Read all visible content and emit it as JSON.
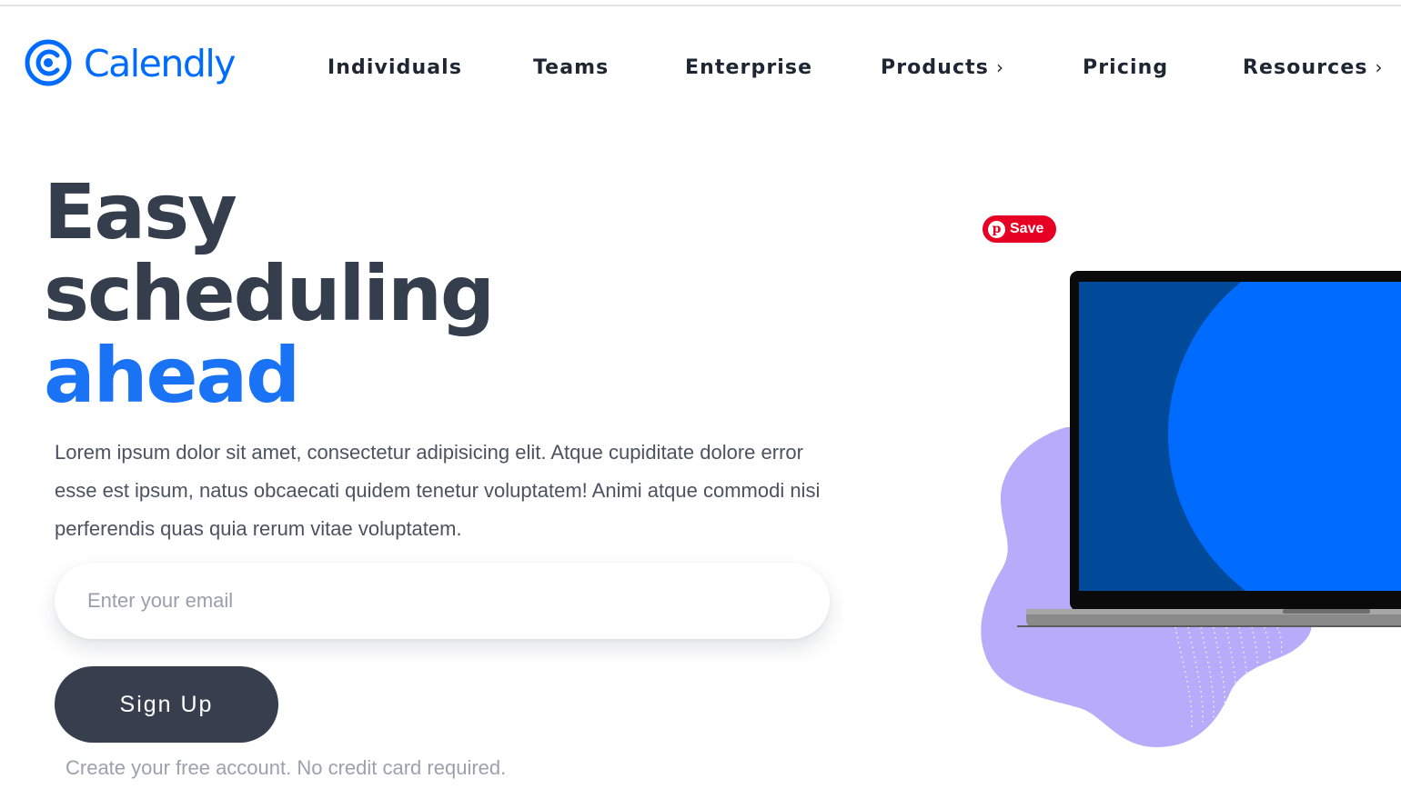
{
  "brand": {
    "name": "Calendly",
    "color": "#006bff"
  },
  "nav": {
    "items": [
      {
        "label": "Individuals",
        "has_chevron": false
      },
      {
        "label": "Teams",
        "has_chevron": false
      },
      {
        "label": "Enterprise",
        "has_chevron": false
      },
      {
        "label": "Products",
        "has_chevron": true
      },
      {
        "label": "Pricing",
        "has_chevron": false
      },
      {
        "label": "Resources",
        "has_chevron": true
      }
    ],
    "chevron_glyph": "›"
  },
  "hero": {
    "headline_lines": [
      "Easy",
      "scheduling"
    ],
    "headline_accent": "ahead",
    "description": "Lorem ipsum dolor sit amet, consectetur adipisicing elit. Atque cupiditate dolore error esse est ipsum, natus obcaecati quidem tenetur voluptatem! Animi atque commodi nisi perferendis quas quia rerum vitae voluptatem.",
    "email_placeholder": "Enter your email",
    "email_value": "",
    "signup_label": "Sign Up",
    "footnote": "Create your free account. No credit card required."
  },
  "pinterest": {
    "label": "Save",
    "icon": "pinterest-icon",
    "color": "#e60023"
  },
  "colors": {
    "heading": "#353e4d",
    "accent": "#1a73f5",
    "button": "#373f4e",
    "blob": "#b8acfa",
    "screen_dark": "#004a99",
    "screen_light": "#006bff"
  }
}
